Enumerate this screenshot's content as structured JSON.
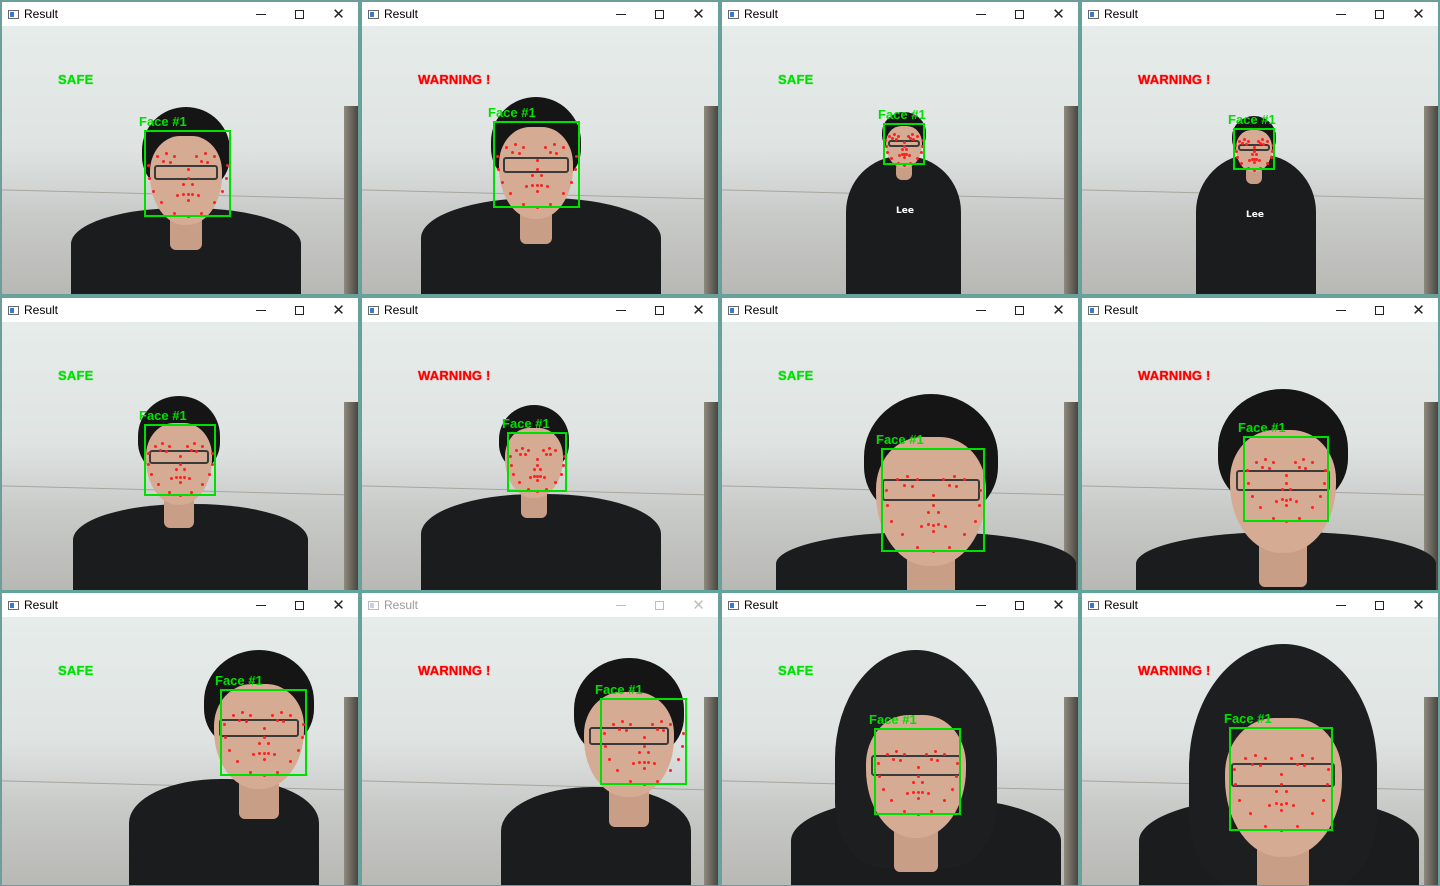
{
  "screen": {
    "background_color": "#6f9f9a"
  },
  "colors": {
    "safe": "#00e000",
    "warning": "#ff0000",
    "landmark": "#ff2020",
    "face_box": "#00e000"
  },
  "windows": [
    {
      "title": "Result",
      "status": "SAFE",
      "status_type": "safe",
      "active": true,
      "face_label": "Face #1"
    },
    {
      "title": "Result",
      "status": "WARNING !",
      "status_type": "warn",
      "active": true,
      "face_label": "Face #1"
    },
    {
      "title": "Result",
      "status": "SAFE",
      "status_type": "safe",
      "active": true,
      "face_label": "Face #1",
      "logo": "Lee"
    },
    {
      "title": "Result",
      "status": "WARNING !",
      "status_type": "warn",
      "active": true,
      "face_label": "Face #1",
      "logo": "Lee"
    },
    {
      "title": "Result",
      "status": "SAFE",
      "status_type": "safe",
      "active": true,
      "face_label": "Face #1"
    },
    {
      "title": "Result",
      "status": "WARNING !",
      "status_type": "warn",
      "active": true,
      "face_label": "Face #1"
    },
    {
      "title": "Result",
      "status": "SAFE",
      "status_type": "safe",
      "active": true,
      "face_label": "Face #1"
    },
    {
      "title": "Result",
      "status": "WARNING !",
      "status_type": "warn",
      "active": true,
      "face_label": "Face #1"
    },
    {
      "title": "Result",
      "status": "SAFE",
      "status_type": "safe",
      "active": true,
      "face_label": "Face #1"
    },
    {
      "title": "Result",
      "status": "WARNING !",
      "status_type": "warn",
      "active": false,
      "face_label": "Face #1"
    },
    {
      "title": "Result",
      "status": "SAFE",
      "status_type": "safe",
      "active": true,
      "face_label": "Face #1"
    },
    {
      "title": "Result",
      "status": "WARNING !",
      "status_type": "warn",
      "active": true,
      "face_label": "Face #1"
    }
  ],
  "titlebar_buttons": {
    "minimize": "minimize-icon",
    "maximize": "maximize-icon",
    "close": "close-icon"
  }
}
